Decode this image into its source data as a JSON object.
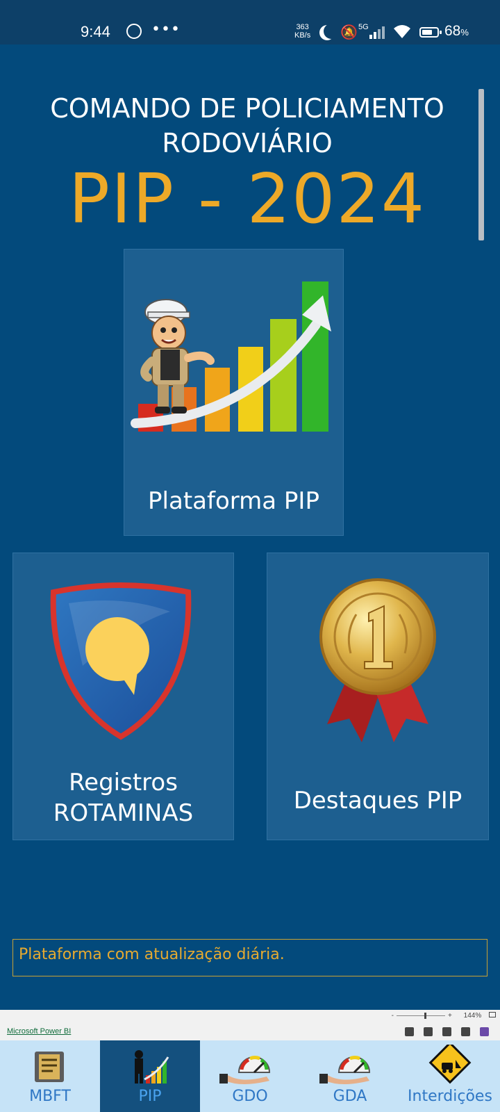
{
  "status_bar": {
    "time": "9:44",
    "speed_value": "363",
    "speed_unit": "KB/s",
    "network": "5G",
    "battery_percent": "68",
    "battery_level": 0.68,
    "percent_sign": "%"
  },
  "header": {
    "line1": "COMANDO DE POLICIAMENTO",
    "line2": "RODOVIÁRIO",
    "big_title": "PIP - 2024"
  },
  "tiles": {
    "plataforma": "Plataforma PIP",
    "registros_line1": "Registros",
    "registros_line2": "ROTAMINAS",
    "destaques": "Destaques PIP"
  },
  "info_text": "Plataforma com atualização diária.",
  "powerbi": {
    "zoom": "144%",
    "minus": "-",
    "plus": "+",
    "link": "Microsoft Power BI"
  },
  "nav": {
    "items": [
      {
        "label": "MBFT",
        "active": false
      },
      {
        "label": "PIP",
        "active": true
      },
      {
        "label": "GDO",
        "active": false
      },
      {
        "label": "GDA",
        "active": false
      },
      {
        "label": "Interdições",
        "active": false
      }
    ]
  },
  "colors": {
    "background": "#034a7c",
    "tile": "#1d5f90",
    "accent_gold": "#eda928",
    "nav_bg": "#c6e3f7",
    "nav_active": "#14507e"
  }
}
